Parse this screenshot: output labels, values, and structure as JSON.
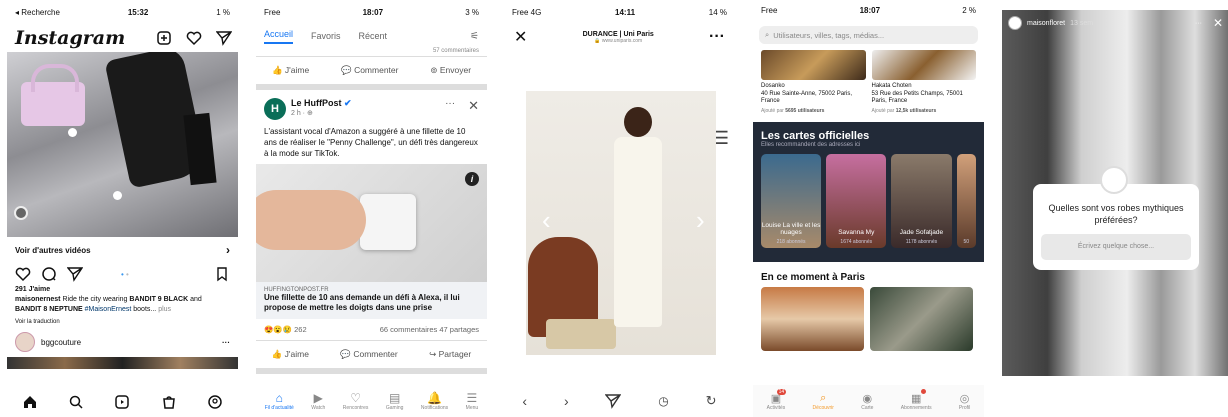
{
  "instagram": {
    "status": {
      "carrier": "◂ Recherche",
      "time": "15:32",
      "battery": "1 %"
    },
    "logo": "Instagram",
    "see_more": "Voir d'autres vidéos",
    "likes": "291 J'aime",
    "caption_user": "maisonernest",
    "caption_pre": " Ride the city wearing ",
    "caption_b1": "BANDIT 9 BLACK",
    "caption_mid": " and ",
    "caption_b2": "BANDIT 8 NEPTUNE",
    "caption_tag": " #MaisonErnest",
    "caption_end": " boots... ",
    "caption_more": "plus",
    "translate": "Voir la traduction",
    "next_user": "bggcouture"
  },
  "facebook": {
    "status": {
      "carrier": "Free",
      "time": "18:07",
      "battery": "3 %"
    },
    "tabs": [
      "Accueil",
      "Favoris",
      "Récent"
    ],
    "prev_comments": "57 commentaires",
    "actions": {
      "like": "J'aime",
      "comment": "Commenter",
      "send": "Envoyer",
      "share": "Partager"
    },
    "page": "Le HuffPost",
    "time_ago": "2 h · ",
    "text": "L'assistant vocal d'Amazon a suggéré à une fillette de 10 ans de réaliser le \"Penny Challenge\", un défi très dangereux à la mode sur TikTok.",
    "source": "HUFFINGTONPOST.FR",
    "headline": "Une fillette de 10 ans demande un défi à Alexa, il lui propose de mettre les doigts dans une prise",
    "reactions": "262",
    "comments": "66 commentaires",
    "shares": "47 partages",
    "nav": [
      "Fil d'actualité",
      "Watch",
      "Rencontres",
      "Gaming",
      "Notifications",
      "Menu"
    ]
  },
  "product": {
    "status": {
      "carrier": "Free 4G",
      "time": "14:11",
      "battery": "14 %"
    },
    "title": "DURANCE | Uni Paris",
    "url": "🔒 www.uniparis.com"
  },
  "maps": {
    "status": {
      "carrier": "Free",
      "time": "18:07",
      "battery": "2 %"
    },
    "search_placeholder": "Utilisateurs, villes, tags, médias...",
    "places": [
      {
        "name": "Dosanko",
        "address": "40 Rue Sainte-Anne, 75002 Paris, France",
        "added": "Ajouté par ",
        "count": "5695 utilisateurs"
      },
      {
        "name": "Hakata Choten",
        "address": "53 Rue des Petits Champs, 75001 Paris, France",
        "added": "Ajouté par ",
        "count": "12,5k utilisateurs"
      }
    ],
    "official_title": "Les cartes officielles",
    "official_sub": "Elles recommandent des adresses ici",
    "officials": [
      {
        "name": "Louise La ville et les nuages",
        "subs": "218 abonnés"
      },
      {
        "name": "Savanna My",
        "subs": "1674 abonnés"
      },
      {
        "name": "Jade Sofatjade",
        "subs": "1178 abonnés"
      },
      {
        "name": "",
        "subs": "50"
      }
    ],
    "now_title": "En ce moment à Paris",
    "nav": [
      "Activités",
      "Découvrir",
      "Carte",
      "Abonnements",
      "Profil"
    ],
    "badges": [
      "14",
      ""
    ]
  },
  "story": {
    "user": "maisonfloret",
    "age": "13 sem",
    "question": "Quelles sont vos robes mythiques préférées?",
    "placeholder": "Écrivez quelque chose..."
  }
}
